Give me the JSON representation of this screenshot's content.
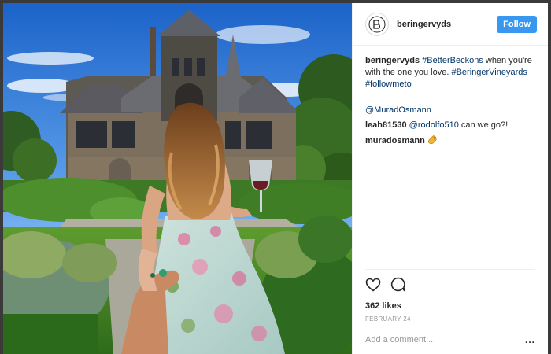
{
  "post": {
    "username": "beringervyds",
    "follow_label": "Follow",
    "caption": {
      "user": "beringervyds",
      "tag1": "#BetterBeckons",
      "text1": " when you're with the one you love. ",
      "tag2": "#BeringerVineyards",
      "space": " ",
      "tag3": "#followmeto"
    },
    "comments": [
      {
        "mention": "@MuradOsmann"
      },
      {
        "user": "leah81530",
        "mention": "@rodolfo510",
        "text": " can we go?!"
      },
      {
        "user": "muradosmann",
        "emoji": "clapping-hands-icon"
      }
    ],
    "likes": "362 likes",
    "date": "FEBRUARY 24",
    "comment_placeholder": "Add a comment...",
    "more_label": "..."
  },
  "icons": {
    "like": "heart-icon",
    "comment": "speech-bubble-icon",
    "more": "more-options-icon"
  },
  "colors": {
    "follow_button": "#3897f0",
    "link": "#003569",
    "background": "#3a3a3a"
  }
}
